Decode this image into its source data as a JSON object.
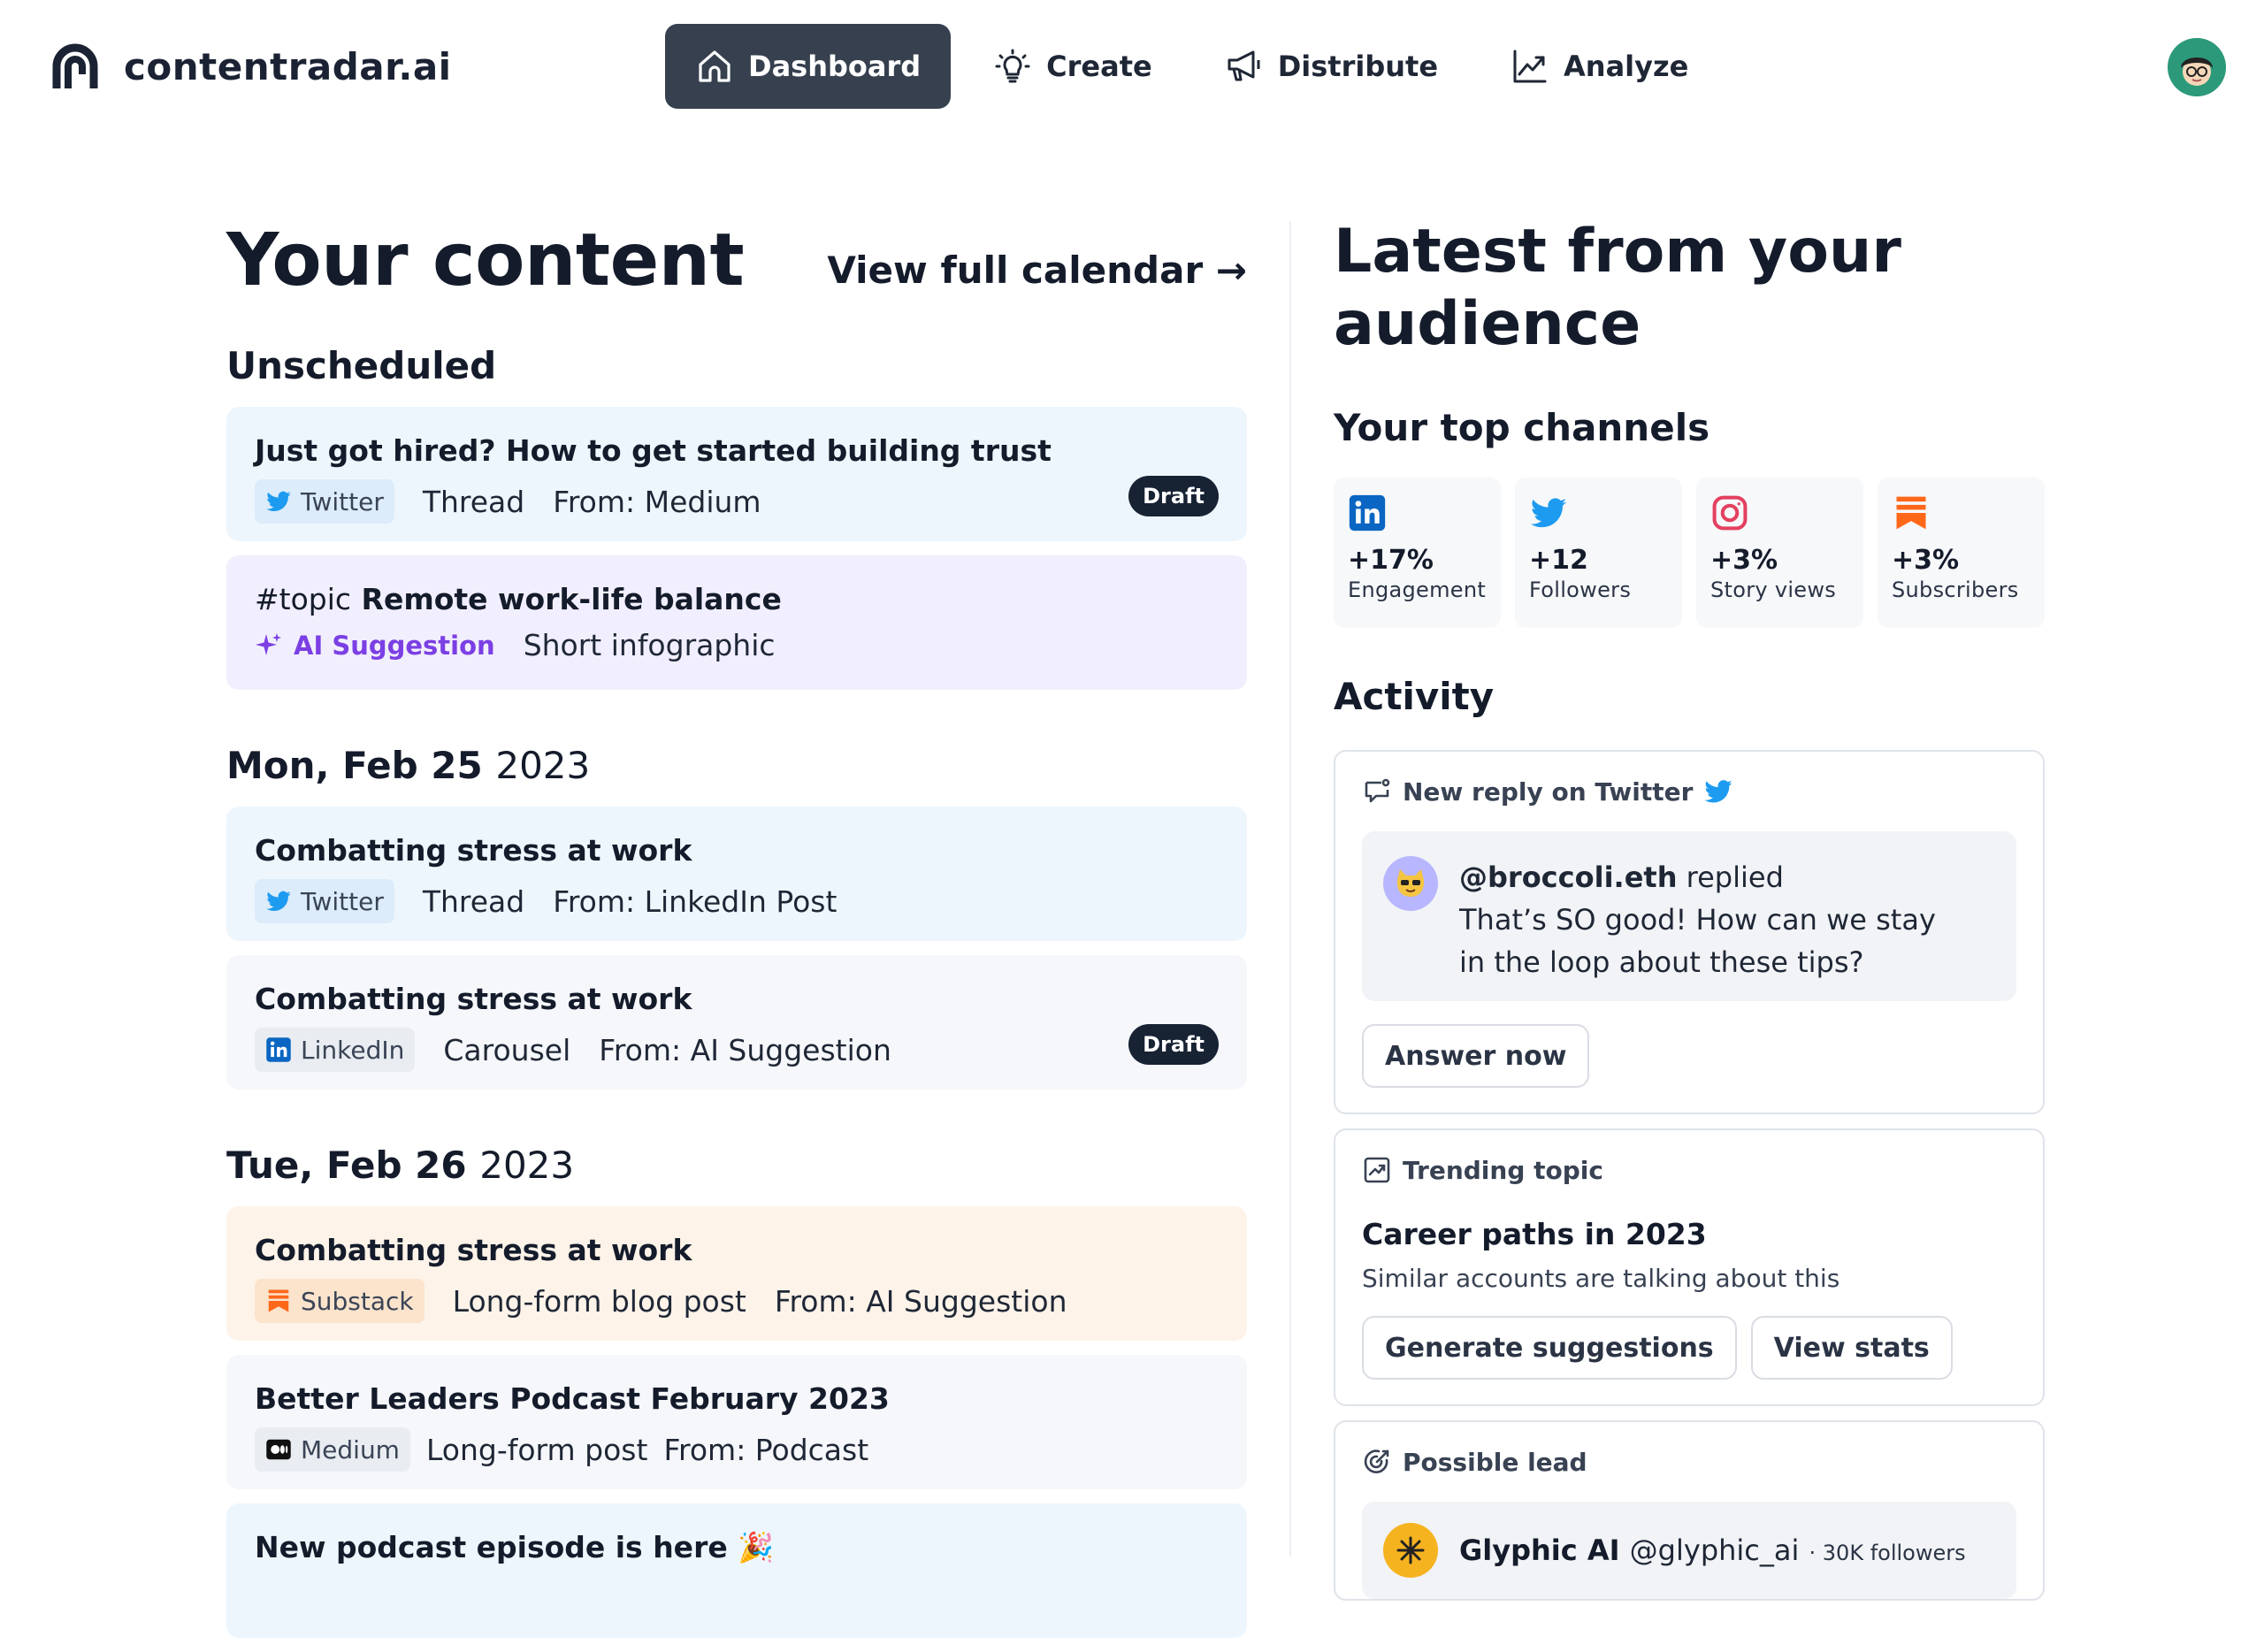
{
  "brand": {
    "name": "contentradar.ai"
  },
  "nav": [
    {
      "label": "Dashboard",
      "icon": "home-icon",
      "active": true
    },
    {
      "label": "Create",
      "icon": "lightbulb-icon",
      "active": false
    },
    {
      "label": "Distribute",
      "icon": "megaphone-icon",
      "active": false
    },
    {
      "label": "Analyze",
      "icon": "trend-chart-icon",
      "active": false
    }
  ],
  "content": {
    "title": "Your content",
    "calendar_link": "View full calendar →",
    "unscheduled": {
      "heading": "Unscheduled",
      "items": [
        {
          "title": "Just got hired? How to get started building trust",
          "platform": "Twitter",
          "format": "Thread",
          "source": "From: Medium",
          "badge": "Draft"
        },
        {
          "tag": "#topic",
          "title": "Remote work-life balance",
          "suggestion_label": "AI Suggestion",
          "format": "Short infographic"
        }
      ]
    },
    "days": [
      {
        "date": "Mon, Feb 25",
        "year": "2023",
        "items": [
          {
            "title": "Combatting stress at work",
            "platform": "Twitter",
            "format": "Thread",
            "source": "From: LinkedIn Post"
          },
          {
            "title": "Combatting stress at work",
            "platform": "LinkedIn",
            "format": "Carousel",
            "source": "From: AI Suggestion",
            "badge": "Draft"
          }
        ]
      },
      {
        "date": "Tue, Feb 26",
        "year": "2023",
        "items": [
          {
            "title": "Combatting stress at work",
            "platform": "Substack",
            "format": "Long-form blog post",
            "source": "From: AI Suggestion"
          },
          {
            "title": "Better Leaders Podcast February 2023",
            "platform": "Medium",
            "format": "Long-form post",
            "source": "From: Podcast"
          },
          {
            "title": "New podcast episode is here 🎉"
          }
        ]
      }
    ]
  },
  "audience": {
    "title_line1": "Latest from your",
    "title_line2": "audience",
    "channels_heading": "Your top channels",
    "channels": [
      {
        "icon": "linkedin-icon",
        "value": "+17%",
        "label": "Engagement"
      },
      {
        "icon": "twitter-icon",
        "value": "+12",
        "label": "Followers"
      },
      {
        "icon": "instagram-icon",
        "value": "+3%",
        "label": "Story views"
      },
      {
        "icon": "substack-icon",
        "value": "+3%",
        "label": "Subscribers"
      }
    ],
    "activity_heading": "Activity",
    "reply": {
      "header": "New reply on Twitter",
      "handle": "@broccoli.eth",
      "action": "replied",
      "message": "That’s SO good! How can we stay in the loop about these tips?",
      "button": "Answer now"
    },
    "trending": {
      "header": "Trending topic",
      "topic": "Career paths in 2023",
      "subtitle": "Similar accounts are talking about this",
      "buttons": [
        "Generate suggestions",
        "View stats"
      ]
    },
    "lead": {
      "header": "Possible lead",
      "name": "Glyphic AI",
      "handle": "@glyphic_ai",
      "followers": "· 30K followers"
    }
  },
  "colors": {
    "twitter": "#1d9bf0",
    "linkedin": "#0a66c2",
    "instagram": "#e4405f",
    "substack": "#ff6719",
    "ai_purple": "#7b3fe4",
    "nav_active": "#36404f"
  }
}
